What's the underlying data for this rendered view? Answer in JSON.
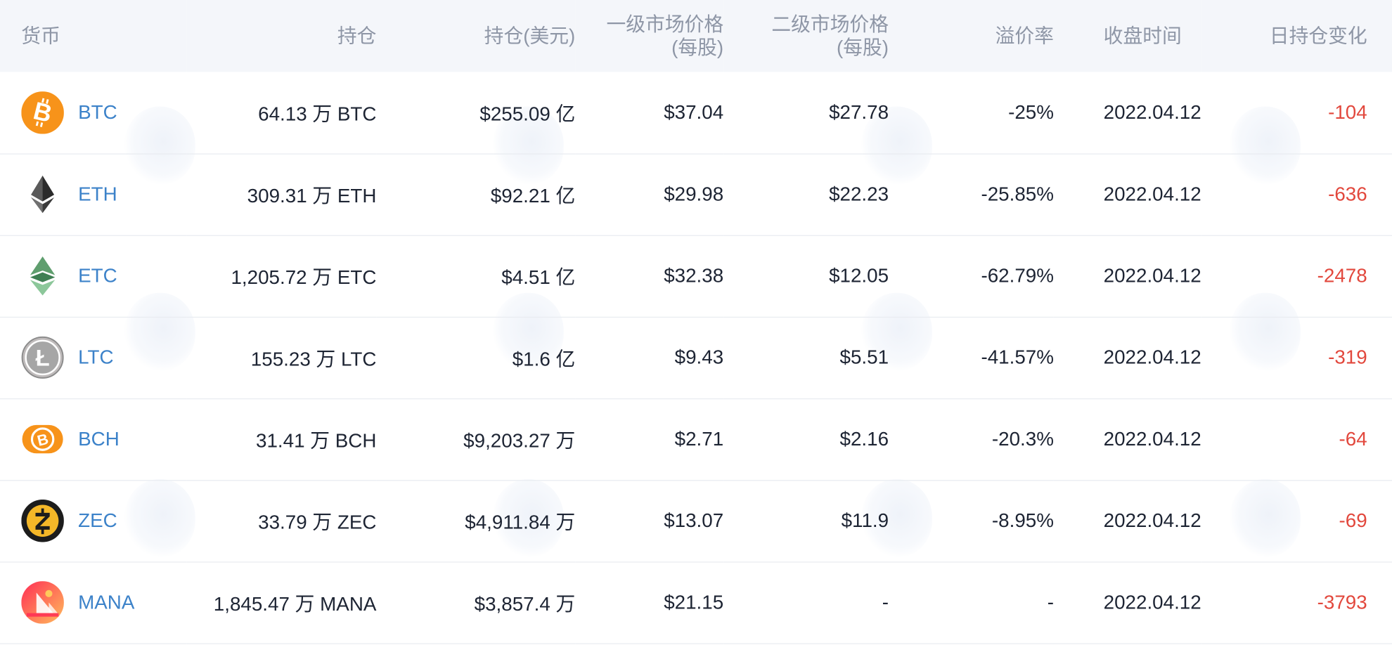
{
  "table": {
    "headers": {
      "coin": "货币",
      "holdings": "持仓",
      "holdings_usd": "持仓(美元)",
      "primary_price_line1": "一级市场价格",
      "primary_price_line2": "(每股)",
      "secondary_price_line1": "二级市场价格",
      "secondary_price_line2": "(每股)",
      "premium": "溢价率",
      "close_time": "收盘时间",
      "daily_change": "日持仓变化"
    },
    "rows": [
      {
        "icon": "btc-icon",
        "coin": "BTC",
        "holdings": "64.13 万 BTC",
        "holdings_usd": "$255.09 亿",
        "primary_price": "$37.04",
        "secondary_price": "$27.78",
        "premium": "-25%",
        "close_time": "2022.04.12",
        "daily_change": "-104"
      },
      {
        "icon": "eth-icon",
        "coin": "ETH",
        "holdings": "309.31 万 ETH",
        "holdings_usd": "$92.21 亿",
        "primary_price": "$29.98",
        "secondary_price": "$22.23",
        "premium": "-25.85%",
        "close_time": "2022.04.12",
        "daily_change": "-636"
      },
      {
        "icon": "etc-icon",
        "coin": "ETC",
        "holdings": "1,205.72 万 ETC",
        "holdings_usd": "$4.51 亿",
        "primary_price": "$32.38",
        "secondary_price": "$12.05",
        "premium": "-62.79%",
        "close_time": "2022.04.12",
        "daily_change": "-2478"
      },
      {
        "icon": "ltc-icon",
        "coin": "LTC",
        "holdings": "155.23 万 LTC",
        "holdings_usd": "$1.6 亿",
        "primary_price": "$9.43",
        "secondary_price": "$5.51",
        "premium": "-41.57%",
        "close_time": "2022.04.12",
        "daily_change": "-319"
      },
      {
        "icon": "bch-icon",
        "coin": "BCH",
        "holdings": "31.41 万 BCH",
        "holdings_usd": "$9,203.27 万",
        "primary_price": "$2.71",
        "secondary_price": "$2.16",
        "premium": "-20.3%",
        "close_time": "2022.04.12",
        "daily_change": "-64"
      },
      {
        "icon": "zec-icon",
        "coin": "ZEC",
        "holdings": "33.79 万 ZEC",
        "holdings_usd": "$4,911.84 万",
        "primary_price": "$13.07",
        "secondary_price": "$11.9",
        "premium": "-8.95%",
        "close_time": "2022.04.12",
        "daily_change": "-69"
      },
      {
        "icon": "mana-icon",
        "coin": "MANA",
        "holdings": "1,845.47 万 MANA",
        "holdings_usd": "$3,857.4 万",
        "primary_price": "$21.15",
        "secondary_price": "-",
        "premium": "-",
        "close_time": "2022.04.12",
        "daily_change": "-3793"
      }
    ]
  },
  "colors": {
    "coin_link": "#3c82c9",
    "negative_change": "#e2483d",
    "header_background": "#f4f6fa",
    "header_text": "#8e96a6",
    "body_text": "#1d2433"
  }
}
